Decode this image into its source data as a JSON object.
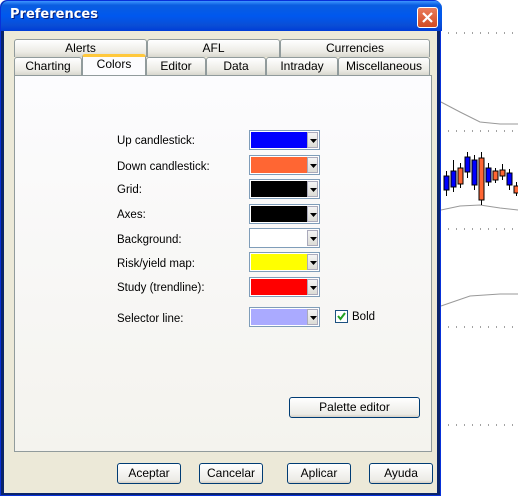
{
  "window": {
    "title": "Preferences"
  },
  "tabs_row1": [
    "Alerts",
    "AFL",
    "Currencies"
  ],
  "tabs_row2": [
    "Charting",
    "Colors",
    "Editor",
    "Data",
    "Intraday",
    "Miscellaneous"
  ],
  "active_tab": "Colors",
  "colors": [
    {
      "label": "Up candlestick:",
      "color": "#0000ff"
    },
    {
      "label": "Down candlestick:",
      "color": "#ff6633"
    },
    {
      "label": "Grid:",
      "color": "#000000"
    },
    {
      "label": "Axes:",
      "color": "#000000"
    },
    {
      "label": "Background:",
      "color": "#ffffff"
    },
    {
      "label": "Risk/yield map:",
      "color": "#ffff00"
    },
    {
      "label": "Study (trendline):",
      "color": "#ff0000"
    },
    {
      "label": "Selector line:",
      "color": "#aaaaff"
    }
  ],
  "bold_checkbox": {
    "label": "Bold",
    "checked": true
  },
  "palette_button": "Palette editor",
  "footer_buttons": [
    "Aceptar",
    "Cancelar",
    "Aplicar",
    "Ayuda"
  ],
  "background_chart": {
    "candles": [
      {
        "color": "#0000ff"
      },
      {
        "color": "#0000ff"
      },
      {
        "color": "#ff6633"
      },
      {
        "color": "#0000ff"
      },
      {
        "color": "#0000ff"
      },
      {
        "color": "#ff6633"
      },
      {
        "color": "#0000ff"
      },
      {
        "color": "#ff6633"
      },
      {
        "color": "#ff6633"
      },
      {
        "color": "#0000ff"
      },
      {
        "color": "#ff6633"
      }
    ]
  }
}
